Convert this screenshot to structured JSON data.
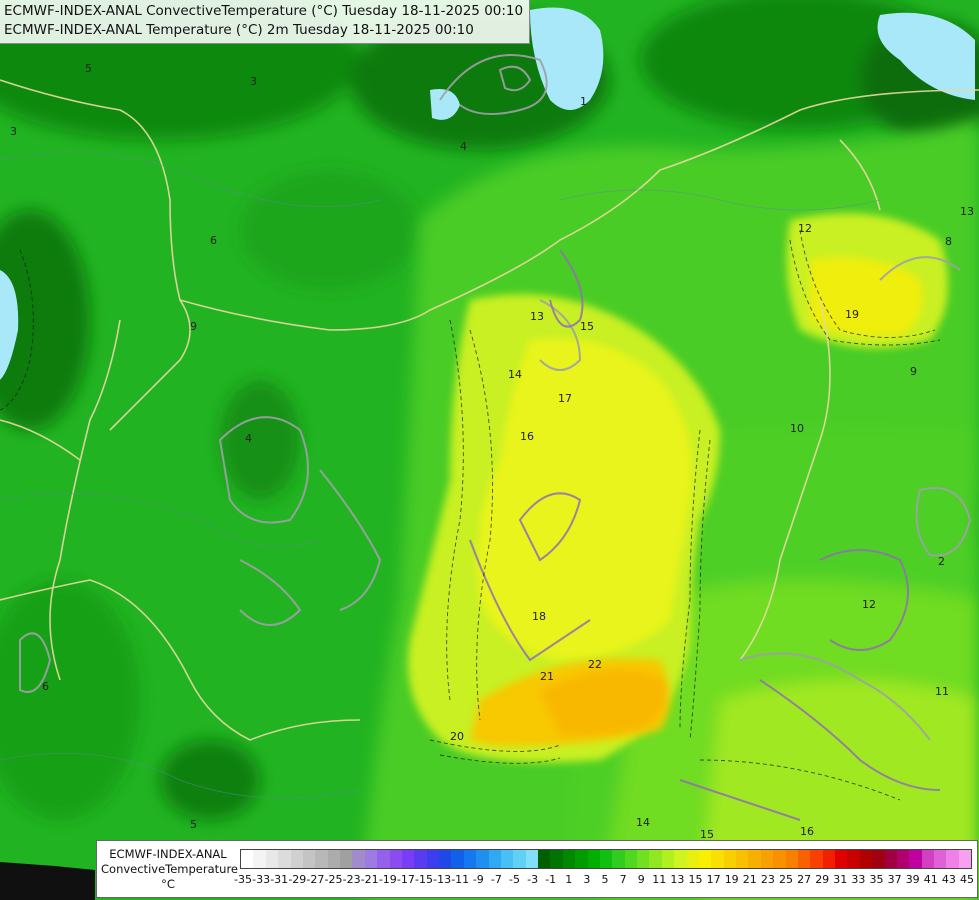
{
  "title_lines": [
    "ECMWF-INDEX-ANAL ConvectiveTemperature (°C) Tuesday 18-11-2025 00:10",
    "ECMWF-INDEX-ANAL Temperature (°C) 2m Tuesday 18-11-2025 00:10"
  ],
  "legend": {
    "label_lines": [
      "ECMWF-INDEX-ANAL",
      "ConvectiveTemperature",
      "°C"
    ],
    "tick_labels": [
      "-35",
      "-33",
      "-31",
      "-29",
      "-27",
      "-25",
      "-23",
      "-21",
      "-19",
      "-17",
      "-15",
      "-13",
      "-11",
      "-9",
      "-7",
      "-5",
      "-3",
      "-1",
      "1",
      "3",
      "5",
      "7",
      "9",
      "11",
      "13",
      "15",
      "17",
      "19",
      "21",
      "23",
      "25",
      "27",
      "29",
      "31",
      "33",
      "35",
      "37",
      "39",
      "41",
      "43",
      "45"
    ],
    "colors": [
      "#ffffff",
      "#f4f4f4",
      "#e8e8e8",
      "#dcdcdc",
      "#d0d0d0",
      "#c4c4c4",
      "#b8b8b8",
      "#acacac",
      "#a0a0a0",
      "#a08cc8",
      "#9c7ce0",
      "#9460ec",
      "#8a4cf0",
      "#7a3cf4",
      "#5a3cf0",
      "#3c3cf0",
      "#2048e8",
      "#1060e8",
      "#1478f0",
      "#2090f0",
      "#30a8f4",
      "#48c0f4",
      "#60d0f4",
      "#80e0f8",
      "#006000",
      "#007400",
      "#008800",
      "#009c00",
      "#00b000",
      "#10c010",
      "#30cc20",
      "#50d820",
      "#70e020",
      "#90e820",
      "#b0f020",
      "#d0f420",
      "#e8f010",
      "#f8f000",
      "#f8e000",
      "#f8d000",
      "#f8c000",
      "#f8b000",
      "#f8a000",
      "#f89000",
      "#f88000",
      "#f86000",
      "#f84000",
      "#f02000",
      "#e00000",
      "#c80000",
      "#b00000",
      "#a00010",
      "#a00040",
      "#b00070",
      "#c000a0",
      "#d040c0",
      "#e060d8",
      "#f080e8",
      "#f8a0f0"
    ]
  },
  "map_labels": [
    "4",
    "5",
    "3",
    "6",
    "9",
    "4",
    "12",
    "13",
    "15",
    "14",
    "16",
    "17",
    "18",
    "19",
    "20",
    "21",
    "22",
    "10",
    "11",
    "14",
    "15",
    "16",
    "13",
    "9",
    "6",
    "5",
    "3",
    "12",
    "1",
    "2",
    "8"
  ]
}
